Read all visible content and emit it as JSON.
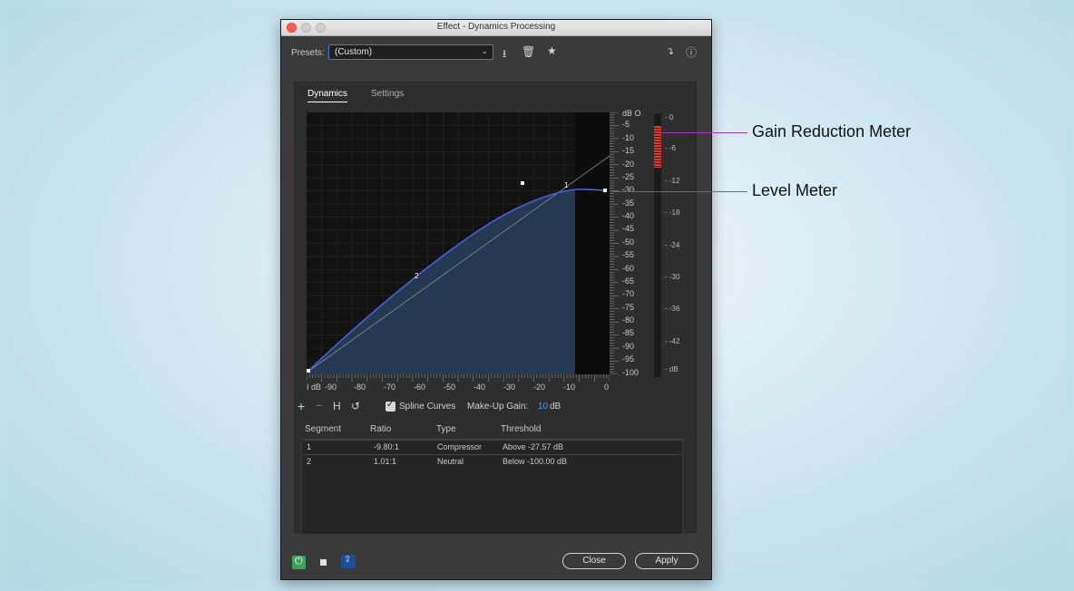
{
  "window": {
    "title": "Effect - Dynamics Processing"
  },
  "presets": {
    "label": "Presets:",
    "value": "(Custom)"
  },
  "tabs": [
    {
      "label": "Dynamics"
    },
    {
      "label": "Settings"
    }
  ],
  "graph": {
    "y_labels": [
      "-5",
      "-10",
      "-15",
      "-20",
      "-25",
      "-30",
      "-35",
      "-40",
      "-45",
      "-50",
      "-55",
      "-60",
      "-65",
      "-70",
      "-75",
      "-80",
      "-85",
      "-90",
      "-95",
      "-100"
    ],
    "y_top_label": "dB",
    "x_labels": [
      "dB",
      "-90",
      "-80",
      "-70",
      "-60",
      "-50",
      "-40",
      "-30",
      "-20",
      "-10",
      "0"
    ],
    "point_labels": [
      "1",
      "2"
    ]
  },
  "gr_meter": {
    "labels": [
      "0",
      "-6",
      "-12",
      "-18",
      "-24",
      "-30",
      "-36",
      "-42",
      "dB"
    ]
  },
  "toolbar": {
    "spline_label": "Spline Curves",
    "makeup_label": "Make-Up Gain:",
    "makeup_value": "10",
    "makeup_unit": "dB"
  },
  "table": {
    "headers": [
      "Segment",
      "Ratio",
      "Type",
      "Threshold"
    ],
    "rows": [
      {
        "segment": "1",
        "ratio": "-9.80:1",
        "type": "Compressor",
        "threshold": "Above -27.57 dB"
      },
      {
        "segment": "2",
        "ratio": "1.01:1",
        "type": "Neutral",
        "threshold": "Below -100.00 dB"
      }
    ]
  },
  "buttons": {
    "close": "Close",
    "apply": "Apply"
  },
  "callouts": {
    "gain_reduction": "Gain Reduction Meter",
    "level": "Level Meter"
  },
  "colors": {
    "accent": "#3d7bd0",
    "curve": "#4a5fd8",
    "fill": "#243a52",
    "callout": "#a43cc2",
    "gr_meter": "#d63b32",
    "power": "#3aa35a"
  }
}
